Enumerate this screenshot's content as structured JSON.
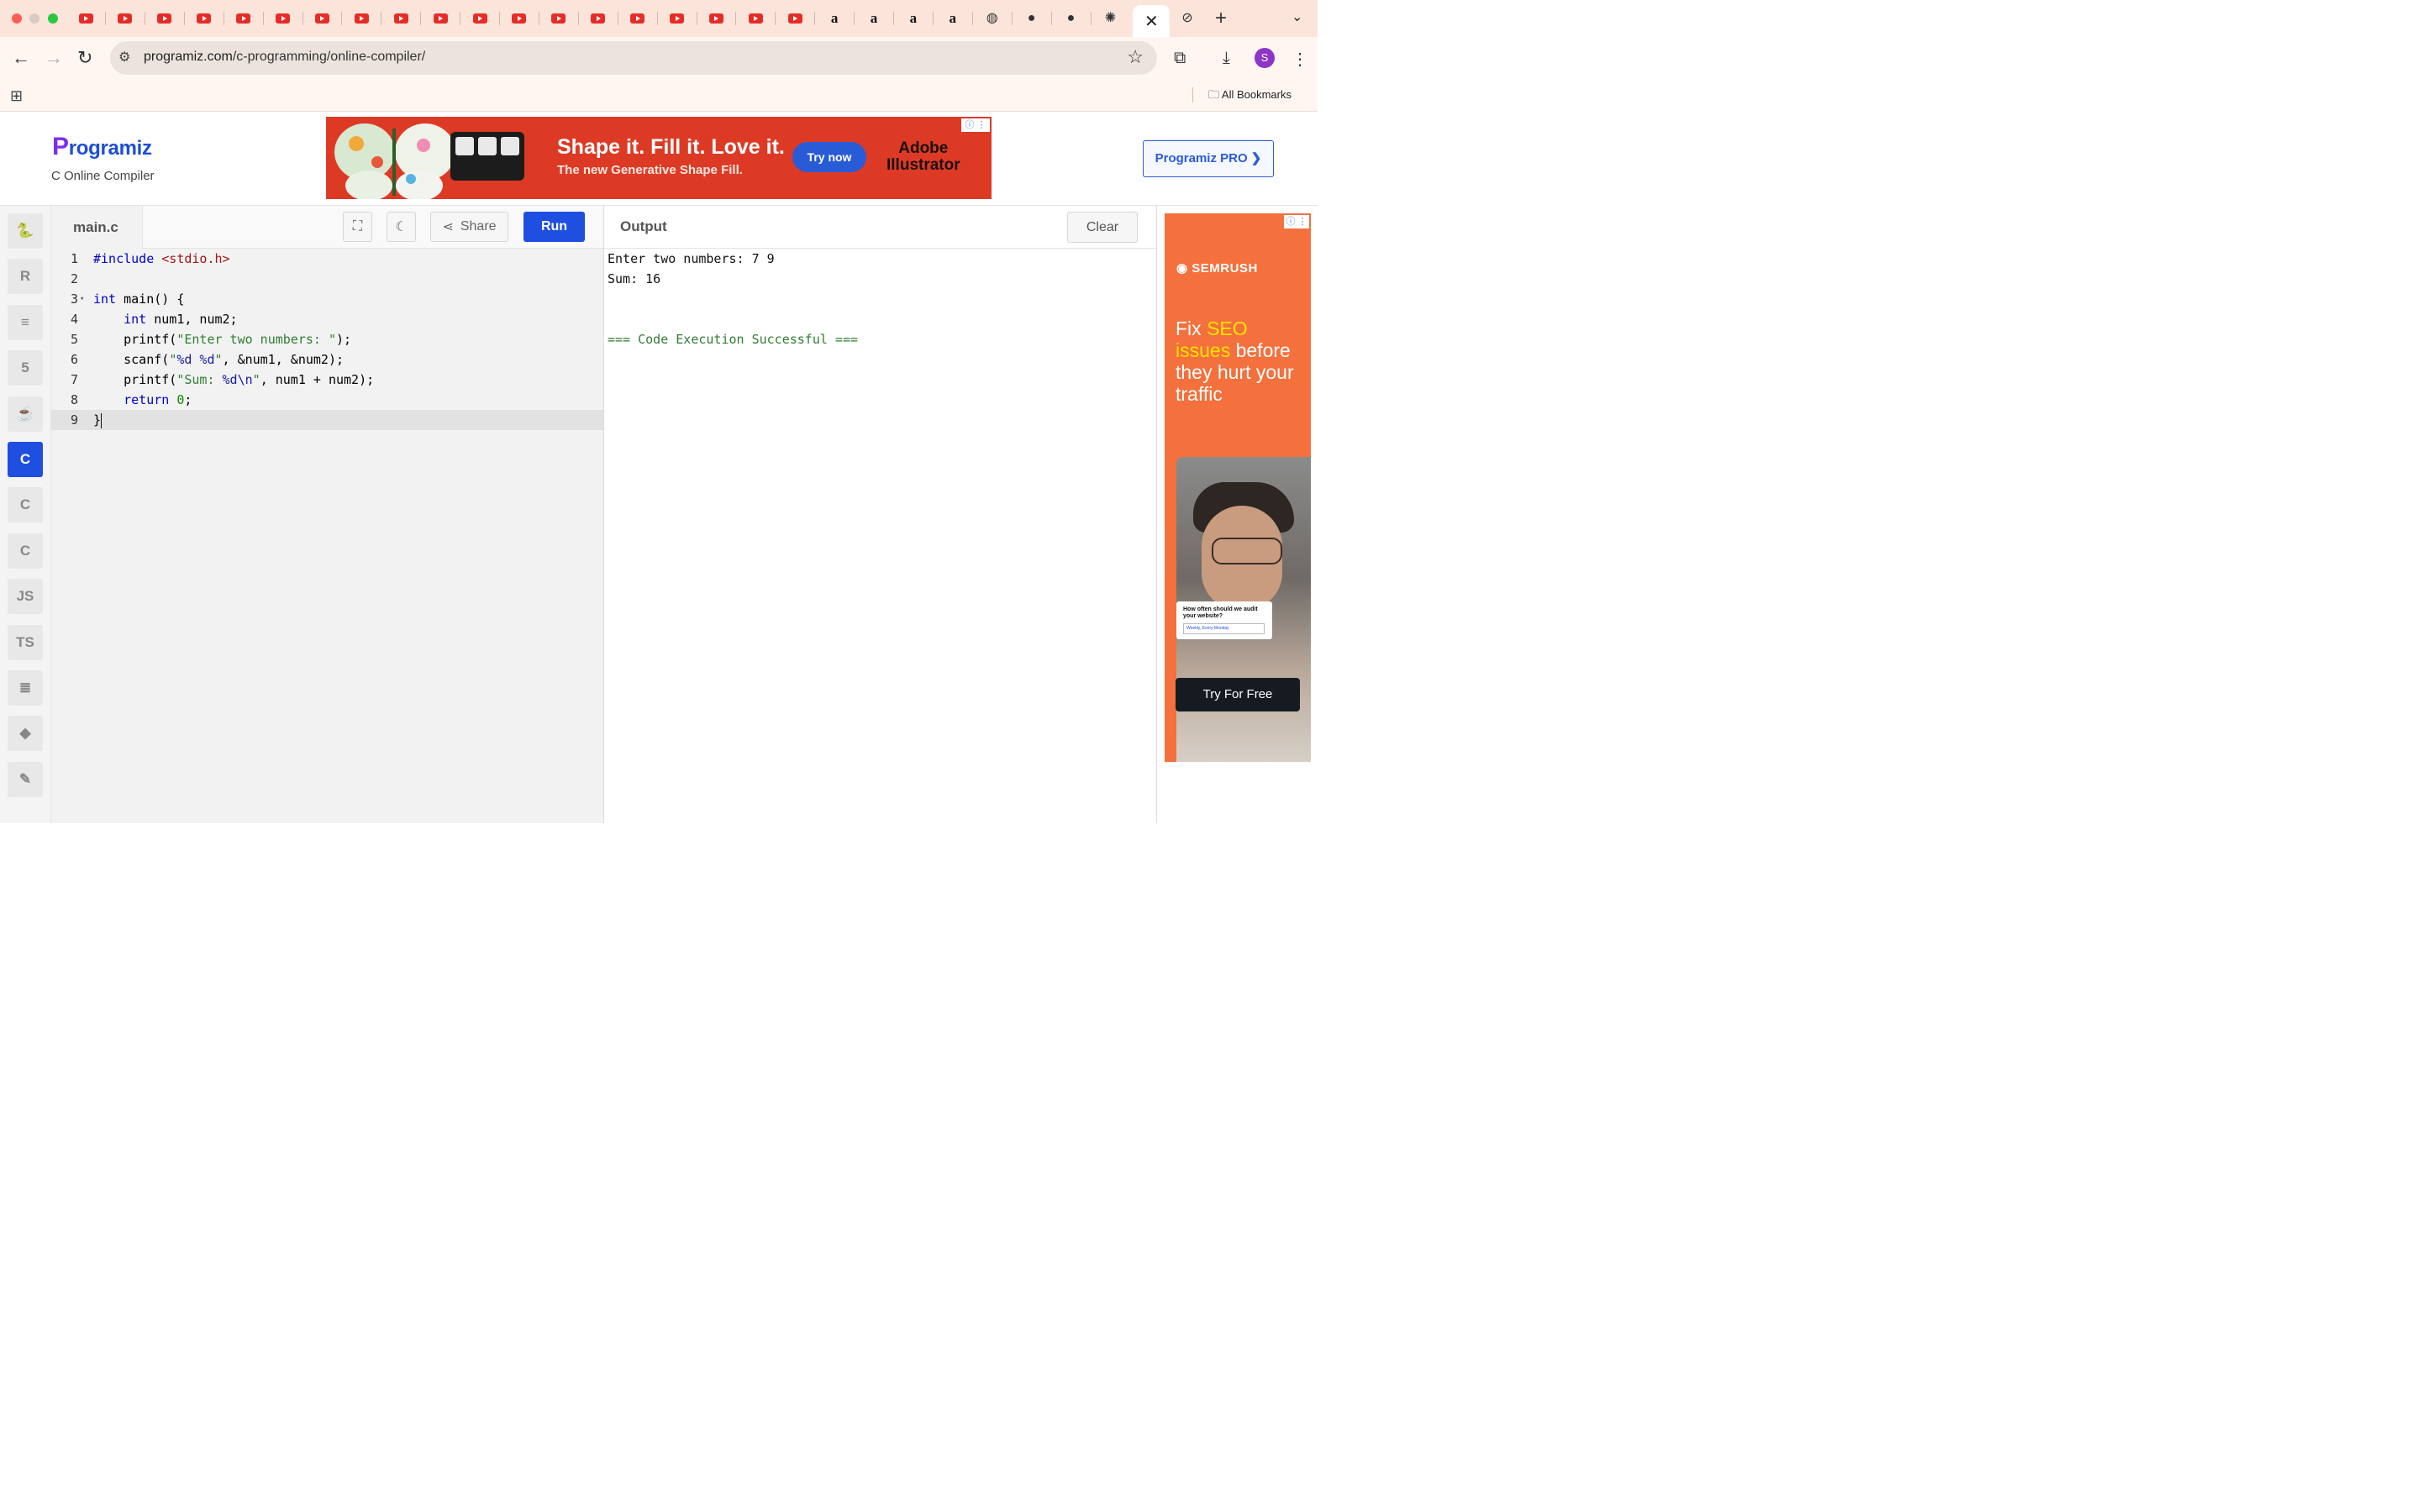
{
  "browser": {
    "tab_icons": [
      "youtube",
      "youtube",
      "youtube",
      "youtube",
      "youtube",
      "youtube",
      "youtube",
      "youtube",
      "youtube",
      "youtube",
      "youtube",
      "youtube",
      "youtube",
      "youtube",
      "youtube",
      "youtube",
      "youtube",
      "youtube",
      "youtube",
      "amazon",
      "amazon",
      "amazon",
      "amazon",
      "globe",
      "github",
      "github",
      "openai"
    ],
    "active_tab_close": "✕",
    "url_host": "programiz.com",
    "url_path": "/c-programming/online-compiler/",
    "avatar_letter": "S",
    "bookmarks_label": "All Bookmarks"
  },
  "header": {
    "logo_first": "P",
    "logo_rest": "rogramiz",
    "subtitle": "C Online Compiler",
    "pro_button": "Programiz PRO ❯"
  },
  "top_ad": {
    "headline": "Shape it. Fill it. Love it.",
    "subline": "The new Generative Shape Fill.",
    "cta": "Try now",
    "brand_line1": "Adobe",
    "brand_line2": "Illustrator",
    "info": "ⓘ ⋮"
  },
  "sidebar": {
    "items": [
      {
        "name": "python",
        "label": "🐍"
      },
      {
        "name": "r",
        "label": "R"
      },
      {
        "name": "sql",
        "label": "≡"
      },
      {
        "name": "html",
        "label": "5"
      },
      {
        "name": "java",
        "label": "☕"
      },
      {
        "name": "c",
        "label": "C",
        "active": true
      },
      {
        "name": "cpp",
        "label": "C"
      },
      {
        "name": "csharp",
        "label": "C"
      },
      {
        "name": "js",
        "label": "JS"
      },
      {
        "name": "ts",
        "label": "TS"
      },
      {
        "name": "go",
        "label": "≣"
      },
      {
        "name": "swift",
        "label": "◆"
      },
      {
        "name": "rust",
        "label": "✎"
      }
    ]
  },
  "editor": {
    "file_name": "main.c",
    "share_label": "Share",
    "run_label": "Run",
    "lines": [
      "1",
      "2",
      "3",
      "4",
      "5",
      "6",
      "7",
      "8",
      "9"
    ]
  },
  "output": {
    "title": "Output",
    "clear_label": "Clear",
    "lines": [
      "Enter two numbers: 7 9",
      "Sum: 16",
      "",
      "",
      "=== Code Execution Successful ==="
    ]
  },
  "right_ad": {
    "brand": "SEMRUSH",
    "text_a": "Fix ",
    "text_b": "SEO issues",
    "text_c": " before they hurt your traffic",
    "card_question": "How often should we audit your website?",
    "card_select": "Weekly, Every Monday",
    "cta": "Try For Free",
    "info": "ⓘ ⋮"
  },
  "colors": {
    "accent": "#1f4fe0",
    "tabstrip": "#fbe4da",
    "ad_red": "#dd3a26",
    "ad_orange": "#f4703c"
  }
}
